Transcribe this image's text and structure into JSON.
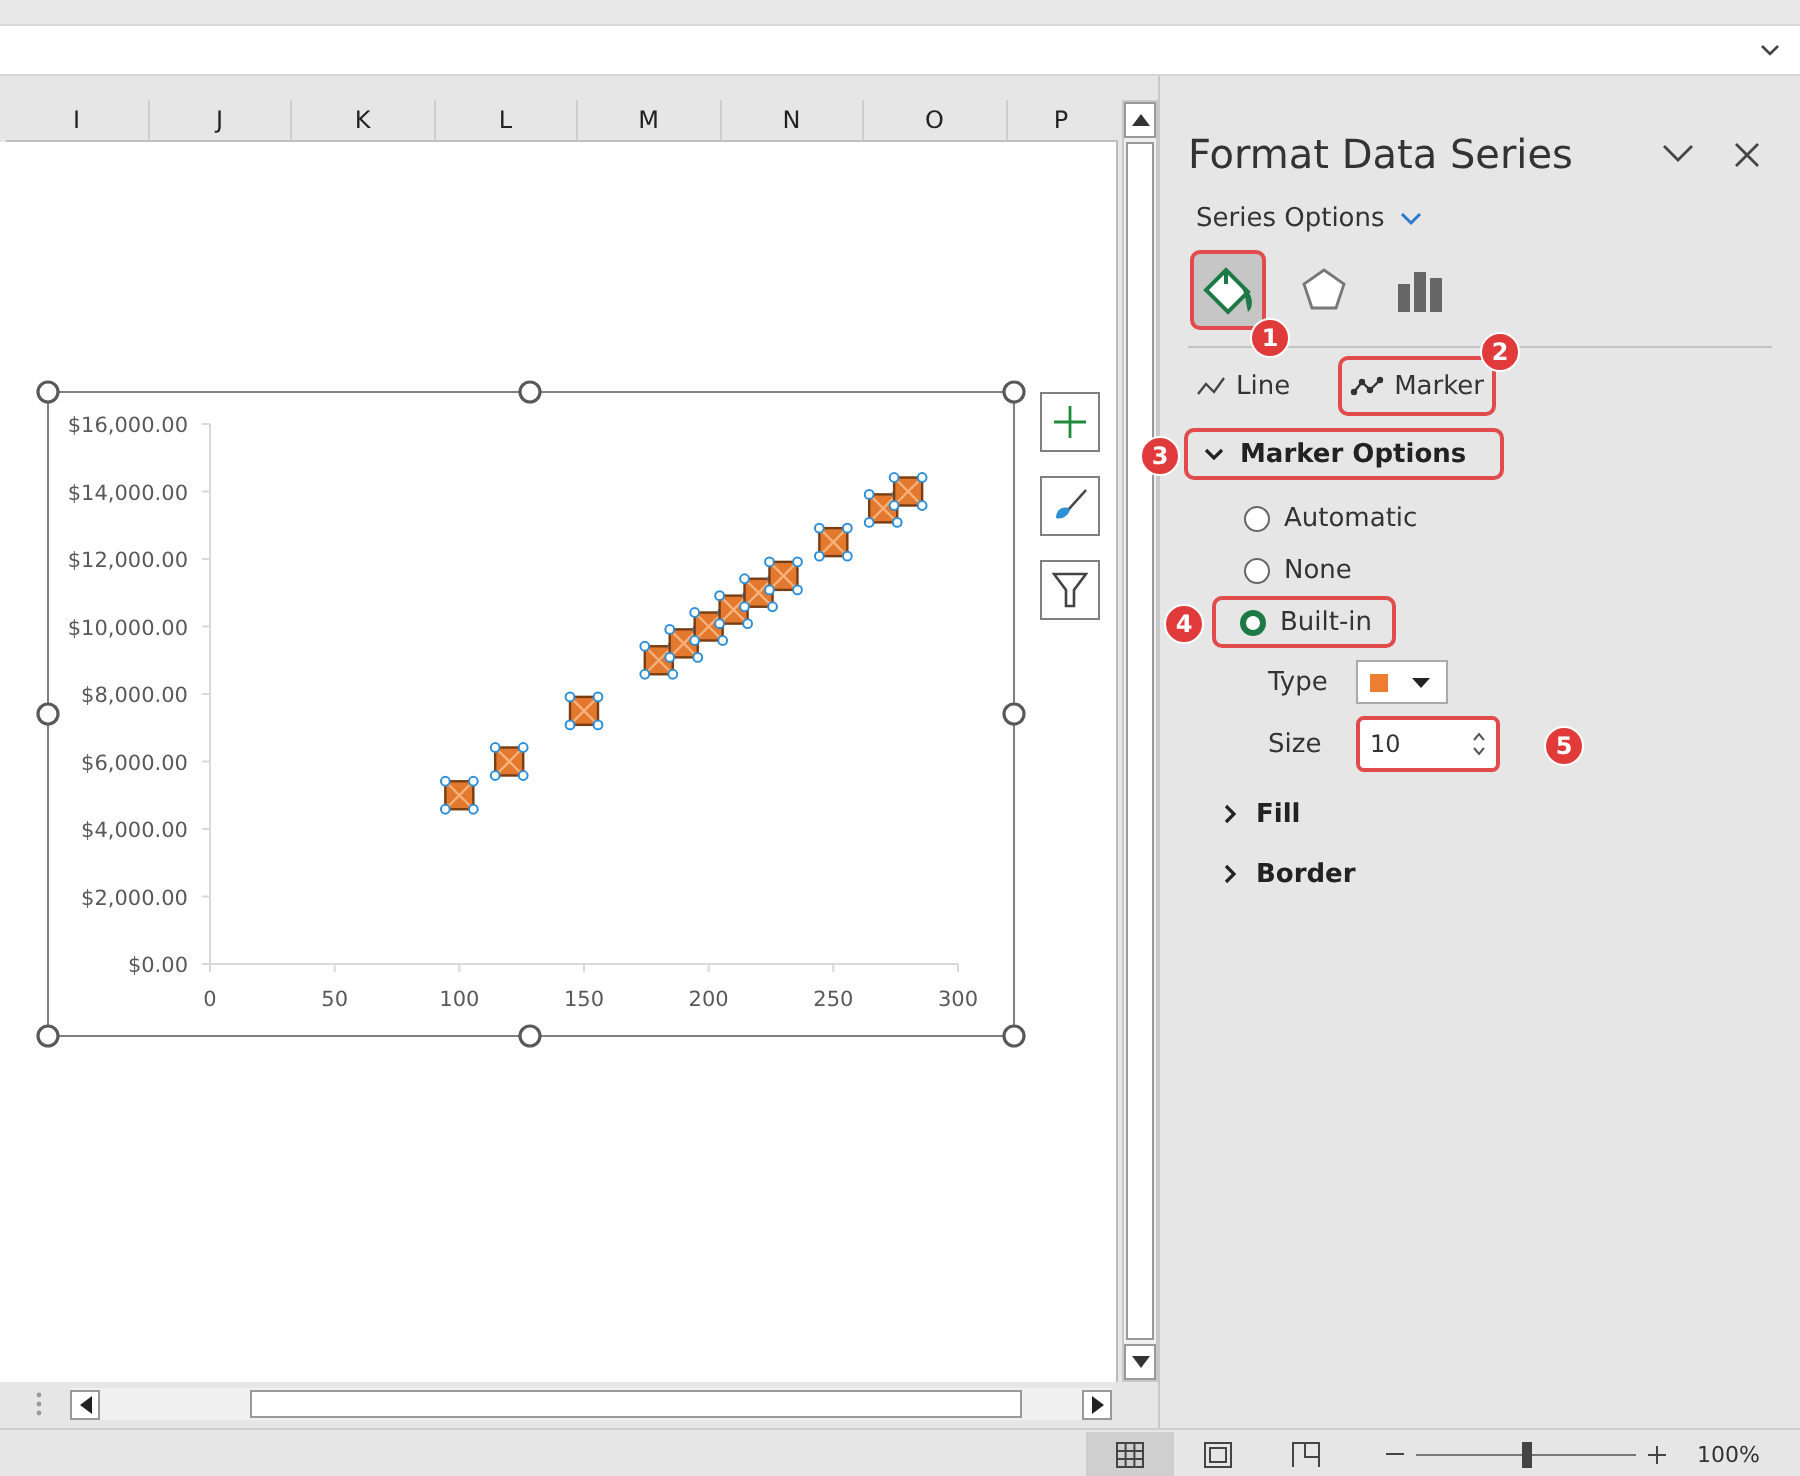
{
  "columns": [
    "I",
    "J",
    "K",
    "L",
    "M",
    "N",
    "O",
    "P"
  ],
  "chart": {
    "chart_data": {
      "type": "scatter",
      "x": [
        100,
        120,
        150,
        180,
        190,
        200,
        210,
        220,
        230,
        250,
        270,
        280
      ],
      "values": [
        5000,
        6000,
        7500,
        9000,
        9500,
        10000,
        10500,
        11000,
        11500,
        12500,
        13500,
        14000
      ],
      "xlim": [
        0,
        300
      ],
      "ylim": [
        0,
        16000
      ],
      "xticks": [
        0,
        50,
        100,
        150,
        200,
        250,
        300
      ],
      "yticks": [
        {
          "value": 0,
          "label": "$0.00"
        },
        {
          "value": 2000,
          "label": "$2,000.00"
        },
        {
          "value": 4000,
          "label": "$4,000.00"
        },
        {
          "value": 6000,
          "label": "$6,000.00"
        },
        {
          "value": 8000,
          "label": "$8,000.00"
        },
        {
          "value": 10000,
          "label": "$10,000.00"
        },
        {
          "value": 12000,
          "label": "$12,000.00"
        },
        {
          "value": 14000,
          "label": "$14,000.00"
        },
        {
          "value": 16000,
          "label": "$16,000.00"
        }
      ]
    }
  },
  "panel": {
    "title": "Format Data Series",
    "options_menu": "Series Options",
    "icon_tabs": [
      {
        "kind": "fill",
        "selected": true,
        "callout": "1"
      },
      {
        "kind": "effects",
        "selected": false
      },
      {
        "kind": "options",
        "selected": false
      }
    ],
    "sub_tabs": [
      {
        "kind": "line",
        "label": "Line"
      },
      {
        "kind": "marker",
        "label": "Marker",
        "callout": "2"
      }
    ],
    "marker_options": {
      "label": "Marker Options",
      "expanded": true,
      "callout": "3",
      "radios": [
        {
          "label": "Automatic",
          "selected": false
        },
        {
          "label": "None",
          "selected": false
        },
        {
          "label": "Built-in",
          "selected": true,
          "callout": "4"
        }
      ],
      "type_label": "Type",
      "size_label": "Size",
      "size_value": "10",
      "size_callout": "5"
    },
    "sections": [
      {
        "label": "Fill",
        "expanded": false
      },
      {
        "label": "Border",
        "expanded": false
      }
    ]
  },
  "status_bar": {
    "views": [
      {
        "kind": "normal",
        "selected": true
      },
      {
        "kind": "page-layout",
        "selected": false
      },
      {
        "kind": "page-break",
        "selected": false
      }
    ],
    "zoom_level": {
      "level": 0.5
    },
    "zoom": "100%"
  }
}
